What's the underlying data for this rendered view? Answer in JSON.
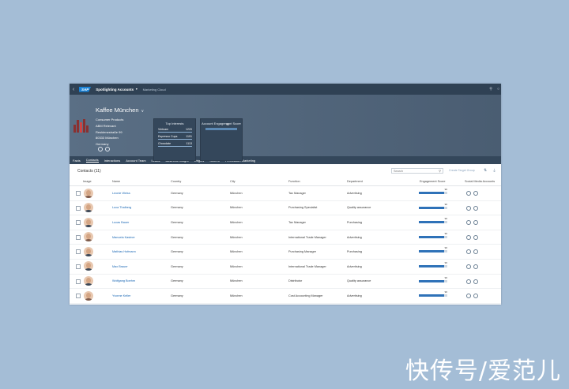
{
  "shell": {
    "title": "Spotlighting Accounts",
    "subtitle": "Marketing Cloud",
    "logo": "SAP",
    "icons": [
      "back-icon",
      "search-icon",
      "help-icon"
    ]
  },
  "account": {
    "name": "Kaffee München",
    "address": [
      "Consumer Products",
      "ABM Relevant",
      "Residenzstraße 99",
      "80333 München",
      "Germany"
    ]
  },
  "top_interests": {
    "title": "Top Interests",
    "items": [
      {
        "label": "Vietnam",
        "value": "1220"
      },
      {
        "label": "Espresso Cups",
        "value": "1191"
      },
      {
        "label": "Chocolate",
        "value": "1113"
      }
    ]
  },
  "engagement_card": {
    "title": "Account Engagement Score",
    "value": "90",
    "level": 0.9
  },
  "tabs": [
    "Facts",
    "Contacts",
    "Interactions",
    "Account Team",
    "Leads",
    "Business Insight",
    "Origins",
    "Scores",
    "Permission Marketing"
  ],
  "contacts": {
    "title": "Contacts (11)",
    "search_placeholder": "Search",
    "create_group": "Create Target Group",
    "columns": [
      "Image",
      "Name",
      "Country",
      "City",
      "Function",
      "Department",
      "Engagement Score",
      "Social Media Accounts"
    ],
    "rows": [
      {
        "name": "Leonie Weiss",
        "country": "Germany",
        "city": "München",
        "function": "Tax Manager",
        "department": "Advertising",
        "score": "90",
        "female": true
      },
      {
        "name": "Luca Thalberg",
        "country": "Germany",
        "city": "München",
        "function": "Purchasing Specialist",
        "department": "Quality assurance",
        "score": "90",
        "female": false
      },
      {
        "name": "Lucas Bauer",
        "country": "Germany",
        "city": "München",
        "function": "Tax Manager",
        "department": "Purchasing",
        "score": "90",
        "female": false
      },
      {
        "name": "Manuela Kastner",
        "country": "Germany",
        "city": "München",
        "function": "International Trade Manager",
        "department": "Advertising",
        "score": "90",
        "female": true
      },
      {
        "name": "Mathias Hofmann",
        "country": "Germany",
        "city": "München",
        "function": "Purchasing Manager",
        "department": "Purchasing",
        "score": "90",
        "female": false
      },
      {
        "name": "Max Brauer",
        "country": "Germany",
        "city": "München",
        "function": "International Trade Manager",
        "department": "Advertising",
        "score": "90",
        "female": false
      },
      {
        "name": "Wolfgang Boehm",
        "country": "Germany",
        "city": "München",
        "function": "Distributor",
        "department": "Quality assurance",
        "score": "90",
        "female": false
      },
      {
        "name": "Yvonne Keller",
        "country": "Germany",
        "city": "München",
        "function": "Cost Accounting Manager",
        "department": "Advertising",
        "score": "90",
        "female": true
      }
    ]
  },
  "watermark": "快传号/爱范儿",
  "colors": {
    "shell": "#2f4154",
    "header": "#4f6378",
    "accent": "#2f72b8",
    "link": "#1866b4",
    "background": "#a4bdd6"
  }
}
